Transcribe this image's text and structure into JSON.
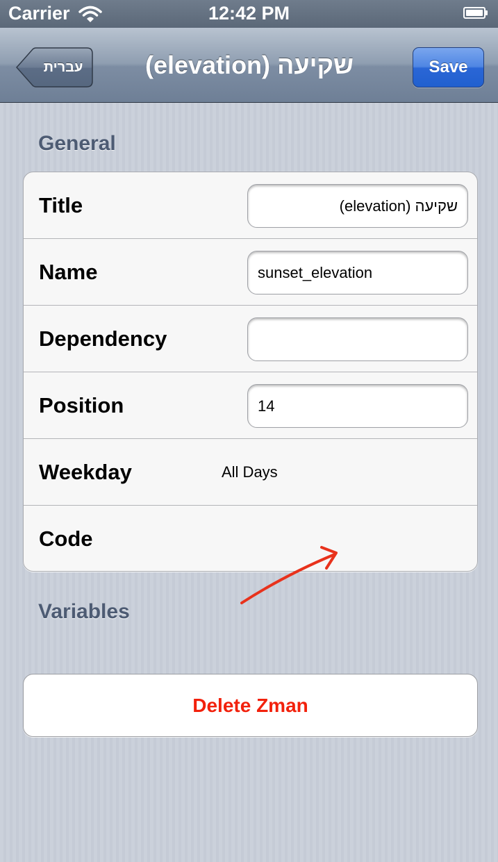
{
  "status_bar": {
    "carrier": "Carrier",
    "time": "12:42 PM",
    "wifi_icon": "wifi-icon",
    "battery_icon": "battery-icon"
  },
  "nav_bar": {
    "back_label": "עברית",
    "title": "שקיעה (elevation)",
    "save_label": "Save"
  },
  "sections": {
    "general": "General",
    "variables": "Variables"
  },
  "form": {
    "title": {
      "label": "Title",
      "value": "שקיעה (elevation)"
    },
    "name": {
      "label": "Name",
      "value": "sunset_elevation"
    },
    "dependency": {
      "label": "Dependency",
      "value": ""
    },
    "position": {
      "label": "Position",
      "value": "14"
    },
    "weekday": {
      "label": "Weekday",
      "value": "All Days"
    },
    "code": {
      "label": "Code"
    }
  },
  "delete_label": "Delete Zman",
  "annotation": {
    "icon": "arrow-annotation-icon",
    "color": "#e8321c"
  },
  "colors": {
    "save_button": "#2a66d6",
    "delete_text": "#f2210c",
    "section_header": "#4d5b73"
  }
}
